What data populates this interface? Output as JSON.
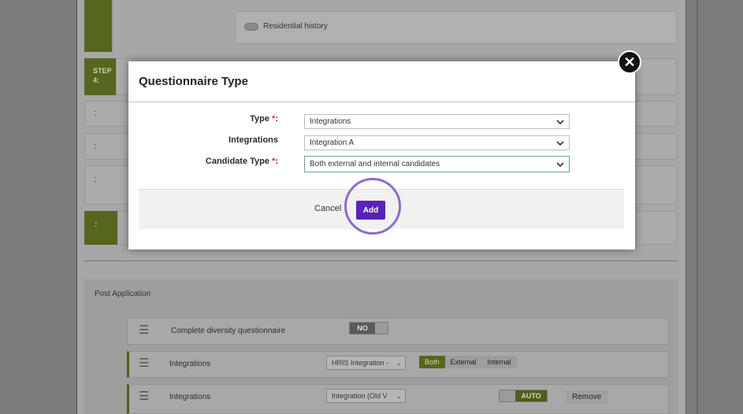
{
  "background": {
    "residential_history_label": "Residential history",
    "step4_label": "STEP 4:",
    "colon_rows": [
      ":",
      ":",
      ":",
      ":"
    ],
    "post_application": {
      "title": "Post Application",
      "rows": [
        {
          "label": "Complete diversity questionnaire",
          "toggle": "NO"
        },
        {
          "label": "Integrations",
          "select": "HRIS Integration -",
          "segments": [
            "Both",
            "External",
            "Internal"
          ],
          "active_segment": "Both"
        },
        {
          "label": "Integrations",
          "select": "Integration (Old V",
          "toggle": "AUTO",
          "remove": "Remove"
        }
      ]
    }
  },
  "modal": {
    "title": "Questionnaire Type",
    "fields": [
      {
        "label": "Type",
        "required": "*",
        "colon": ":",
        "value": "Integrations"
      },
      {
        "label": "Integrations",
        "required": "",
        "colon": "",
        "value": "Integration A"
      },
      {
        "label": "Candidate Type",
        "required": "*",
        "colon": ":",
        "value": "Both external and internal candidates"
      }
    ],
    "cancel_label": "Cancel",
    "add_label": "Add",
    "close_glyph": "✕"
  },
  "colors": {
    "accent_purple": "#5a23b5",
    "step_green": "#56661f",
    "overlay_gray": "#7c7c7c"
  }
}
